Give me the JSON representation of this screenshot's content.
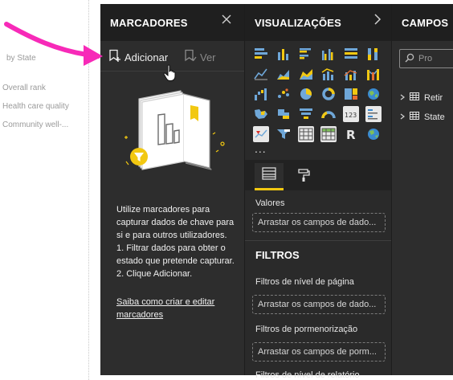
{
  "report_canvas": {
    "items": [
      "by State",
      "Overall rank",
      "Health care quality",
      "Community well-..."
    ]
  },
  "bookmarks_pane": {
    "title": "MARCADORES",
    "close_icon": "close-icon",
    "add_label": "Adicionar",
    "view_label": "Ver",
    "description_lines": [
      "Utilize marcadores para",
      "capturar dados de chave para",
      "si e para outros utilizadores.",
      "1. Filtrar dados para obter o",
      "estado que pretende capturar.",
      "2. Clique Adicionar."
    ],
    "link_lines": [
      "Saiba como criar e editar",
      "marcadores"
    ]
  },
  "visualizations_pane": {
    "title": "VISUALIZAÇÕES",
    "more_label": "...",
    "values_label": "Valores",
    "values_placeholder": "Arrastar os campos de dado...",
    "filters_title": "FILTROS",
    "page_filters_label": "Filtros de nível de página",
    "page_filters_placeholder": "Arrastar os campos de dado...",
    "drill_filters_label": "Filtros de pormenorização",
    "drill_filters_placeholder": "Arrastar os campos de porm...",
    "report_filters_label": "Filtros de nível de relatório"
  },
  "fields_pane": {
    "title": "CAMPOS",
    "search_placeholder": "Pro",
    "tables": [
      "Retir",
      "State"
    ]
  },
  "colors": {
    "pane_bg": "#2d2d2d",
    "header_bg": "#1f1f1f",
    "accent_yellow": "#f2c811",
    "annotation_pink": "#f72ab8"
  }
}
